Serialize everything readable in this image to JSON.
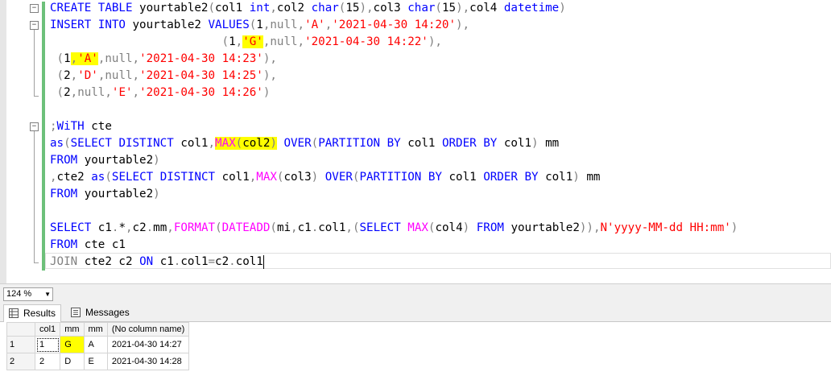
{
  "editor": {
    "lines": [
      [
        {
          "t": "CREATE ",
          "c": "kw"
        },
        {
          "t": "TABLE ",
          "c": "kw"
        },
        {
          "t": "yourtable2"
        },
        {
          "t": "(",
          "c": "gr"
        },
        {
          "t": "col1 "
        },
        {
          "t": "int",
          "c": "kw"
        },
        {
          "t": ",",
          "c": "gr"
        },
        {
          "t": "col2 "
        },
        {
          "t": "char",
          "c": "kw"
        },
        {
          "t": "(",
          "c": "gr"
        },
        {
          "t": "15"
        },
        {
          "t": "),",
          "c": "gr"
        },
        {
          "t": "col3 "
        },
        {
          "t": "char",
          "c": "kw"
        },
        {
          "t": "(",
          "c": "gr"
        },
        {
          "t": "15"
        },
        {
          "t": "),",
          "c": "gr"
        },
        {
          "t": "col4 "
        },
        {
          "t": "datetime",
          "c": "kw"
        },
        {
          "t": ")",
          "c": "gr"
        }
      ],
      [
        {
          "t": "INSERT ",
          "c": "kw"
        },
        {
          "t": "INTO ",
          "c": "kw"
        },
        {
          "t": "yourtable2 "
        },
        {
          "t": "VALUES",
          "c": "kw"
        },
        {
          "t": "(",
          "c": "gr"
        },
        {
          "t": "1"
        },
        {
          "t": ",",
          "c": "gr"
        },
        {
          "t": "null",
          "c": "gr"
        },
        {
          "t": ",",
          "c": "gr"
        },
        {
          "t": "'A'",
          "c": "str"
        },
        {
          "t": ",",
          "c": "gr"
        },
        {
          "t": "'2021-04-30 14:20'",
          "c": "str"
        },
        {
          "t": "),",
          "c": "gr"
        }
      ],
      [
        {
          "t": "                         "
        },
        {
          "t": "(",
          "c": "gr"
        },
        {
          "t": "1"
        },
        {
          "t": ",",
          "c": "gr"
        },
        {
          "t": "'G'",
          "c": "str hl"
        },
        {
          "t": ",",
          "c": "gr"
        },
        {
          "t": "null",
          "c": "gr"
        },
        {
          "t": ",",
          "c": "gr"
        },
        {
          "t": "'2021-04-30 14:22'",
          "c": "str"
        },
        {
          "t": "),",
          "c": "gr"
        }
      ],
      [
        {
          "t": " "
        },
        {
          "t": "(",
          "c": "gr"
        },
        {
          "t": "1"
        },
        {
          "t": ",",
          "c": "gr hl"
        },
        {
          "t": "'A'",
          "c": "str hl"
        },
        {
          "t": ",",
          "c": "gr"
        },
        {
          "t": "null",
          "c": "gr"
        },
        {
          "t": ",",
          "c": "gr"
        },
        {
          "t": "'2021-04-30 14:23'",
          "c": "str"
        },
        {
          "t": "),",
          "c": "gr"
        }
      ],
      [
        {
          "t": " "
        },
        {
          "t": "(",
          "c": "gr"
        },
        {
          "t": "2"
        },
        {
          "t": ",",
          "c": "gr"
        },
        {
          "t": "'D'",
          "c": "str"
        },
        {
          "t": ",",
          "c": "gr"
        },
        {
          "t": "null",
          "c": "gr"
        },
        {
          "t": ",",
          "c": "gr"
        },
        {
          "t": "'2021-04-30 14:25'",
          "c": "str"
        },
        {
          "t": "),",
          "c": "gr"
        }
      ],
      [
        {
          "t": " "
        },
        {
          "t": "(",
          "c": "gr"
        },
        {
          "t": "2"
        },
        {
          "t": ",",
          "c": "gr"
        },
        {
          "t": "null",
          "c": "gr"
        },
        {
          "t": ",",
          "c": "gr"
        },
        {
          "t": "'E'",
          "c": "str"
        },
        {
          "t": ",",
          "c": "gr"
        },
        {
          "t": "'2021-04-30 14:26'",
          "c": "str"
        },
        {
          "t": ")",
          "c": "gr"
        }
      ],
      [],
      [
        {
          "t": ";",
          "c": "gr"
        },
        {
          "t": "WiTH ",
          "c": "kw"
        },
        {
          "t": "cte"
        }
      ],
      [
        {
          "t": "as",
          "c": "kw"
        },
        {
          "t": "(",
          "c": "gr"
        },
        {
          "t": "SELECT ",
          "c": "kw"
        },
        {
          "t": "DISTINCT ",
          "c": "kw"
        },
        {
          "t": "col1"
        },
        {
          "t": ",",
          "c": "gr"
        },
        {
          "t": "MAX",
          "c": "fn hl"
        },
        {
          "t": "(",
          "c": "gr hl"
        },
        {
          "t": "col2",
          "c": "hl"
        },
        {
          "t": ")",
          "c": "gr hl"
        },
        {
          "t": " "
        },
        {
          "t": "OVER",
          "c": "kw"
        },
        {
          "t": "(",
          "c": "gr"
        },
        {
          "t": "PARTITION ",
          "c": "kw"
        },
        {
          "t": "BY ",
          "c": "kw"
        },
        {
          "t": "col1 "
        },
        {
          "t": "ORDER ",
          "c": "kw"
        },
        {
          "t": "BY ",
          "c": "kw"
        },
        {
          "t": "col1"
        },
        {
          "t": ")",
          "c": "gr"
        },
        {
          "t": " mm"
        }
      ],
      [
        {
          "t": "FROM ",
          "c": "kw"
        },
        {
          "t": "yourtable2"
        },
        {
          "t": ")",
          "c": "gr"
        }
      ],
      [
        {
          "t": ",",
          "c": "gr"
        },
        {
          "t": "cte2 "
        },
        {
          "t": "as",
          "c": "kw"
        },
        {
          "t": "(",
          "c": "gr"
        },
        {
          "t": "SELECT ",
          "c": "kw"
        },
        {
          "t": "DISTINCT ",
          "c": "kw"
        },
        {
          "t": "col1"
        },
        {
          "t": ",",
          "c": "gr"
        },
        {
          "t": "MAX",
          "c": "fn"
        },
        {
          "t": "(",
          "c": "gr"
        },
        {
          "t": "col3"
        },
        {
          "t": ")",
          "c": "gr"
        },
        {
          "t": " "
        },
        {
          "t": "OVER",
          "c": "kw"
        },
        {
          "t": "(",
          "c": "gr"
        },
        {
          "t": "PARTITION ",
          "c": "kw"
        },
        {
          "t": "BY ",
          "c": "kw"
        },
        {
          "t": "col1 "
        },
        {
          "t": "ORDER ",
          "c": "kw"
        },
        {
          "t": "BY ",
          "c": "kw"
        },
        {
          "t": "col1"
        },
        {
          "t": ")",
          "c": "gr"
        },
        {
          "t": " mm"
        }
      ],
      [
        {
          "t": "FROM ",
          "c": "kw"
        },
        {
          "t": "yourtable2"
        },
        {
          "t": ")",
          "c": "gr"
        }
      ],
      [],
      [
        {
          "t": "SELECT ",
          "c": "kw"
        },
        {
          "t": "c1"
        },
        {
          "t": ".",
          "c": "gr"
        },
        {
          "t": "*"
        },
        {
          "t": ",",
          "c": "gr"
        },
        {
          "t": "c2"
        },
        {
          "t": ".",
          "c": "gr"
        },
        {
          "t": "mm"
        },
        {
          "t": ",",
          "c": "gr"
        },
        {
          "t": "FORMAT",
          "c": "fn"
        },
        {
          "t": "(",
          "c": "gr"
        },
        {
          "t": "DATEADD",
          "c": "fn"
        },
        {
          "t": "(",
          "c": "gr"
        },
        {
          "t": "mi"
        },
        {
          "t": ",",
          "c": "gr"
        },
        {
          "t": "c1"
        },
        {
          "t": ".",
          "c": "gr"
        },
        {
          "t": "col1"
        },
        {
          "t": ",",
          "c": "gr"
        },
        {
          "t": "(",
          "c": "gr"
        },
        {
          "t": "SELECT ",
          "c": "kw"
        },
        {
          "t": "MAX",
          "c": "fn"
        },
        {
          "t": "(",
          "c": "gr"
        },
        {
          "t": "col4"
        },
        {
          "t": ")",
          "c": "gr"
        },
        {
          "t": " "
        },
        {
          "t": "FROM ",
          "c": "kw"
        },
        {
          "t": "yourtable2"
        },
        {
          "t": ")),",
          "c": "gr"
        },
        {
          "t": "N'yyyy-MM-dd HH:mm'",
          "c": "str"
        },
        {
          "t": ")",
          "c": "gr"
        }
      ],
      [
        {
          "t": "FROM ",
          "c": "kw"
        },
        {
          "t": "cte c1"
        }
      ],
      [
        {
          "t": "JOIN ",
          "c": "gr"
        },
        {
          "t": "cte2 c2 "
        },
        {
          "t": "ON ",
          "c": "kw"
        },
        {
          "t": "c1"
        },
        {
          "t": ".",
          "c": "gr"
        },
        {
          "t": "col1"
        },
        {
          "t": "=",
          "c": "gr"
        },
        {
          "t": "c2"
        },
        {
          "t": ".",
          "c": "gr"
        },
        {
          "t": "col1"
        }
      ]
    ]
  },
  "statusbar": {
    "zoom": "124 %"
  },
  "tabs": {
    "results": "Results",
    "messages": "Messages"
  },
  "grid": {
    "headers": [
      "col1",
      "mm",
      "mm",
      "(No column name)"
    ],
    "rows": [
      {
        "n": "1",
        "cells": [
          "1",
          "G",
          "A",
          "2021-04-30 14:27"
        ]
      },
      {
        "n": "2",
        "cells": [
          "2",
          "D",
          "E",
          "2021-04-30 14:28"
        ]
      }
    ]
  },
  "colors": {
    "keyword": "#0000ff",
    "string": "#ff0000",
    "function": "#ff00ff",
    "highlight": "#ffff00"
  }
}
